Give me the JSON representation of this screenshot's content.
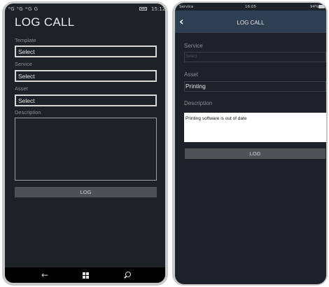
{
  "windows_phone": {
    "status_bar": {
      "left_icons": "⁶G ⁵G ʷG G",
      "time": "15:12"
    },
    "title": "LOG CALL",
    "fields": [
      {
        "label": "Template",
        "value": "Select"
      },
      {
        "label": "Service",
        "value": "Select"
      },
      {
        "label": "Asset",
        "value": "Select"
      }
    ],
    "description_label": "Description",
    "description_value": "",
    "log_button": "LOG",
    "nav_icons": [
      "back-arrow-icon",
      "windows-logo-icon",
      "search-icon"
    ]
  },
  "ios_phone": {
    "status_bar": {
      "carrier": "Service",
      "time": "16:05",
      "battery": "94%"
    },
    "title": "LOG CALL",
    "back_icon": "chevron-left-icon",
    "service": {
      "label": "Service",
      "placeholder": "Select"
    },
    "asset": {
      "label": "Asset",
      "value": "Printing"
    },
    "description": {
      "label": "Description",
      "value": "Printing software is out of date"
    },
    "log_button": "LOG"
  },
  "colors": {
    "screen_bg": "#1d2128",
    "ios_nav_bg": "#2e3f52",
    "button_bg": "#4d5157",
    "bezel": "#c9c9cb"
  }
}
